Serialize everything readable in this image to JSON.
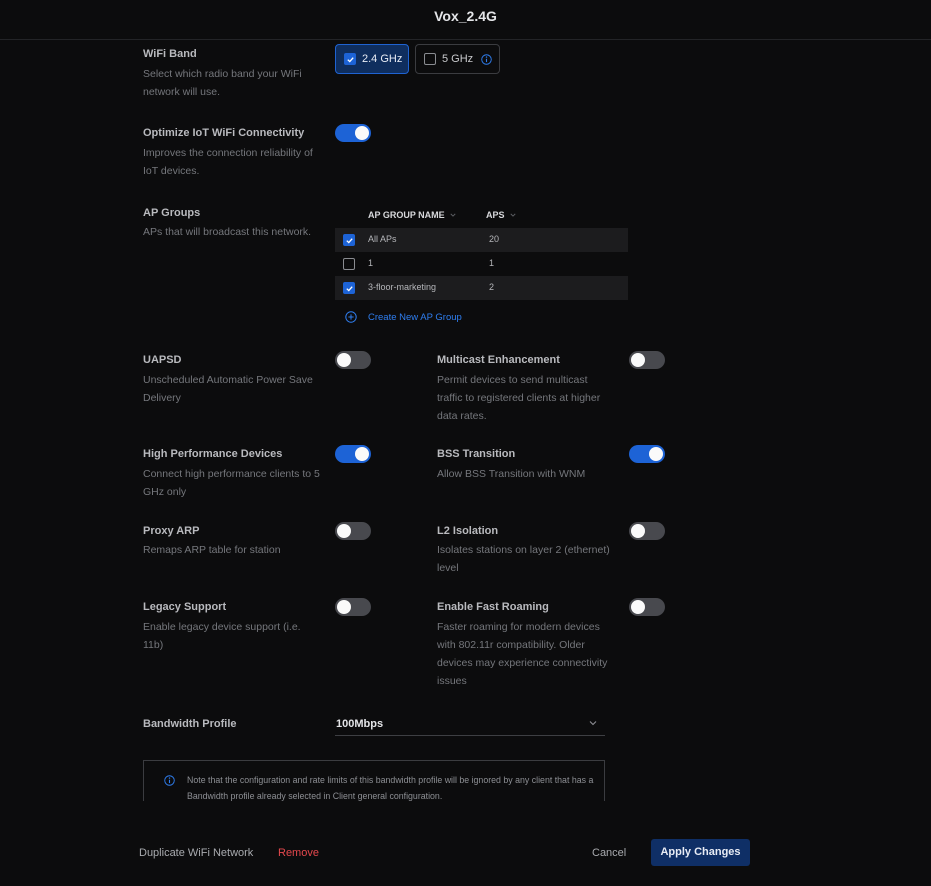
{
  "header": {
    "title": "Vox_2.4G"
  },
  "wifi_band": {
    "label": "WiFi Band",
    "description": "Select which radio band your WiFi network will use.",
    "options": [
      {
        "label": "2.4 GHz",
        "checked": true
      },
      {
        "label": "5 GHz",
        "checked": false
      }
    ]
  },
  "optimize_iot": {
    "label": "Optimize IoT WiFi Connectivity",
    "description": "Improves the connection reliability of IoT devices.",
    "enabled": true
  },
  "ap_groups": {
    "label": "AP Groups",
    "description": "APs that will broadcast this network.",
    "columns": [
      "AP GROUP NAME",
      "APS"
    ],
    "rows": [
      {
        "name": "All APs",
        "aps": "20",
        "checked": true
      },
      {
        "name": "1",
        "aps": "1",
        "checked": false
      },
      {
        "name": "3-floor-marketing",
        "aps": "2",
        "checked": true
      }
    ],
    "create_label": "Create New AP Group"
  },
  "toggles": {
    "uapsd": {
      "label": "UAPSD",
      "description": "Unscheduled Automatic Power Save Delivery",
      "enabled": false
    },
    "multicast": {
      "label": "Multicast Enhancement",
      "description": "Permit devices to send multicast traffic to registered clients at higher data rates.",
      "enabled": false
    },
    "high_perf": {
      "label": "High Performance Devices",
      "description": "Connect high performance clients to 5 GHz only",
      "enabled": true
    },
    "bss": {
      "label": "BSS Transition",
      "description": "Allow BSS Transition with WNM",
      "enabled": true
    },
    "proxy_arp": {
      "label": "Proxy ARP",
      "description": "Remaps ARP table for station",
      "enabled": false
    },
    "l2_isolation": {
      "label": "L2 Isolation",
      "description": "Isolates stations on layer 2 (ethernet) level",
      "enabled": false
    },
    "legacy": {
      "label": "Legacy Support",
      "description": "Enable legacy device support (i.e. 11b)",
      "enabled": false
    },
    "fast_roaming": {
      "label": "Enable Fast Roaming",
      "description": "Faster roaming for modern devices with 802.11r compatibility. Older devices may experience connectivity issues",
      "enabled": false
    }
  },
  "bandwidth": {
    "label": "Bandwidth Profile",
    "value": "100Mbps",
    "note": "Note that the configuration and rate limits of this bandwidth profile will be ignored by any client that has a Bandwidth profile already selected in Client general configuration."
  },
  "footer": {
    "duplicate_label": "Duplicate WiFi Network",
    "remove_label": "Remove",
    "cancel_label": "Cancel",
    "apply_label": "Apply Changes"
  },
  "colors": {
    "accent": "#1d63d6",
    "danger": "#e5484d",
    "background": "#0c0c0d"
  },
  "icons": {
    "checkbox_checked": "check-icon",
    "info": "info-icon",
    "add": "plus-circle-icon",
    "dropdown": "chevron-down-icon"
  }
}
